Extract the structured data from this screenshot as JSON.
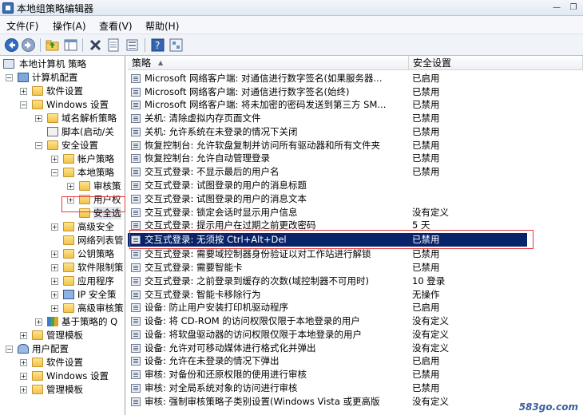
{
  "window": {
    "title": "本地组策略编辑器"
  },
  "menu": [
    {
      "label": "文件(F)"
    },
    {
      "label": "操作(A)"
    },
    {
      "label": "查看(V)"
    },
    {
      "label": "帮助(H)"
    }
  ],
  "toolbar": {
    "buttons": [
      "back-arrow-icon",
      "forward-arrow-icon",
      "up-folder-icon",
      "show-tree-icon",
      "delete-icon",
      "properties-icon",
      "export-list-icon",
      "help-icon",
      "filter-icon"
    ]
  },
  "tree": [
    {
      "label": "本地计算机 策略"
    },
    {
      "label": "计算机配置"
    },
    {
      "label": "软件设置"
    },
    {
      "label": "Windows 设置"
    },
    {
      "label": "域名解析策略"
    },
    {
      "label": "脚本(启动/关"
    },
    {
      "label": "安全设置"
    },
    {
      "label": "帐户策略"
    },
    {
      "label": "本地策略"
    },
    {
      "label": "审核策"
    },
    {
      "label": "用户权"
    },
    {
      "label": "安全选"
    },
    {
      "label": "高级安全"
    },
    {
      "label": "网络列表管"
    },
    {
      "label": "公钥策略"
    },
    {
      "label": "软件限制策"
    },
    {
      "label": "应用程序"
    },
    {
      "label": "IP 安全策"
    },
    {
      "label": "高级审核策"
    },
    {
      "label": "基于策略的 Q"
    },
    {
      "label": "管理模板"
    },
    {
      "label": "用户配置"
    },
    {
      "label": "软件设置"
    },
    {
      "label": "Windows 设置"
    },
    {
      "label": "管理模板"
    }
  ],
  "list": {
    "headers": {
      "policy": "策略",
      "setting": "安全设置"
    },
    "rows": [
      {
        "policy": "Microsoft 网络客户端: 对通信进行数字签名(如果服务器...",
        "setting": "已启用"
      },
      {
        "policy": "Microsoft 网络客户端: 对通信进行数字签名(始终)",
        "setting": "已禁用"
      },
      {
        "policy": "Microsoft 网络客户端: 将未加密的密码发送到第三方 SM...",
        "setting": "已禁用"
      },
      {
        "policy": "关机: 清除虚拟内存页面文件",
        "setting": "已禁用"
      },
      {
        "policy": "关机: 允许系统在未登录的情况下关闭",
        "setting": "已禁用"
      },
      {
        "policy": "恢复控制台: 允许软盘复制并访问所有驱动器和所有文件夹",
        "setting": "已禁用"
      },
      {
        "policy": "恢复控制台: 允许自动管理登录",
        "setting": "已禁用"
      },
      {
        "policy": "交互式登录: 不显示最后的用户名",
        "setting": "已禁用"
      },
      {
        "policy": "交互式登录: 试图登录的用户的消息标题",
        "setting": ""
      },
      {
        "policy": "交互式登录: 试图登录的用户的消息文本",
        "setting": ""
      },
      {
        "policy": "交互式登录: 锁定会话时显示用户信息",
        "setting": "没有定义"
      },
      {
        "policy": "交互式登录: 提示用户在过期之前更改密码",
        "setting": "5 天"
      },
      {
        "policy": "交互式登录: 无须按 Ctrl+Alt+Del",
        "setting": "已禁用"
      },
      {
        "policy": "交互式登录: 需要域控制器身份验证以对工作站进行解锁",
        "setting": "已禁用"
      },
      {
        "policy": "交互式登录: 需要智能卡",
        "setting": "已禁用"
      },
      {
        "policy": "交互式登录: 之前登录到缓存的次数(域控制器不可用时)",
        "setting": "10 登录"
      },
      {
        "policy": "交互式登录: 智能卡移除行为",
        "setting": "无操作"
      },
      {
        "policy": "设备: 防止用户安装打印机驱动程序",
        "setting": "已启用"
      },
      {
        "policy": "设备: 将 CD-ROM 的访问权限仅限于本地登录的用户",
        "setting": "没有定义"
      },
      {
        "policy": "设备: 将软盘驱动器的访问权限仅限于本地登录的用户",
        "setting": "没有定义"
      },
      {
        "policy": "设备: 允许对可移动媒体进行格式化并弹出",
        "setting": "没有定义"
      },
      {
        "policy": "设备: 允许在未登录的情况下弹出",
        "setting": "已启用"
      },
      {
        "policy": "审核: 对备份和还原权限的使用进行审核",
        "setting": "已禁用"
      },
      {
        "policy": "审核: 对全局系统对象的访问进行审核",
        "setting": "已禁用"
      },
      {
        "policy": "审核: 强制审核策略子类别设置(Windows Vista 或更高版",
        "setting": "没有定义"
      }
    ]
  },
  "watermark": "583go.com"
}
